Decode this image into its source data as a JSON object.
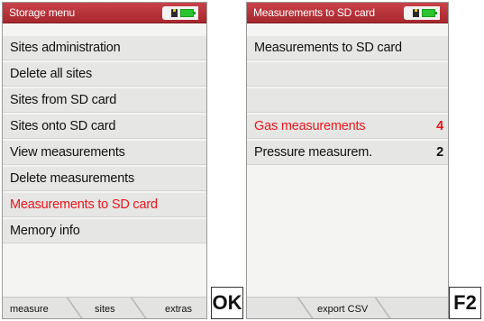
{
  "left_screen": {
    "title": "Storage menu",
    "items": [
      {
        "label": "Sites administration",
        "selected": false
      },
      {
        "label": "Delete all sites",
        "selected": false
      },
      {
        "label": "Sites from SD card",
        "selected": false
      },
      {
        "label": "Sites onto SD card",
        "selected": false
      },
      {
        "label": "View measurements",
        "selected": false
      },
      {
        "label": "Delete measurements",
        "selected": false
      },
      {
        "label": "Measurements to SD card",
        "selected": true
      },
      {
        "label": "Memory info",
        "selected": false
      }
    ],
    "softkeys": [
      "measure",
      "sites",
      "extras"
    ]
  },
  "left_key": "OK",
  "right_screen": {
    "title": "Measurements to SD card",
    "items": [
      {
        "label": "Measurements to SD card",
        "value": "",
        "selected": false
      },
      {
        "label": "",
        "value": "",
        "selected": false
      },
      {
        "label": "",
        "value": "",
        "selected": false
      },
      {
        "label": "Gas measurements",
        "value": "4",
        "selected": true
      },
      {
        "label": "Pressure measurem.",
        "value": "2",
        "selected": false
      }
    ],
    "softkeys": [
      "export CSV"
    ]
  },
  "right_key": "F2",
  "colors": {
    "titlebar": "#b5313a",
    "selected_text": "#e8151b",
    "battery": "#29c42f"
  },
  "icons": [
    "sd-card-icon",
    "battery-icon"
  ]
}
